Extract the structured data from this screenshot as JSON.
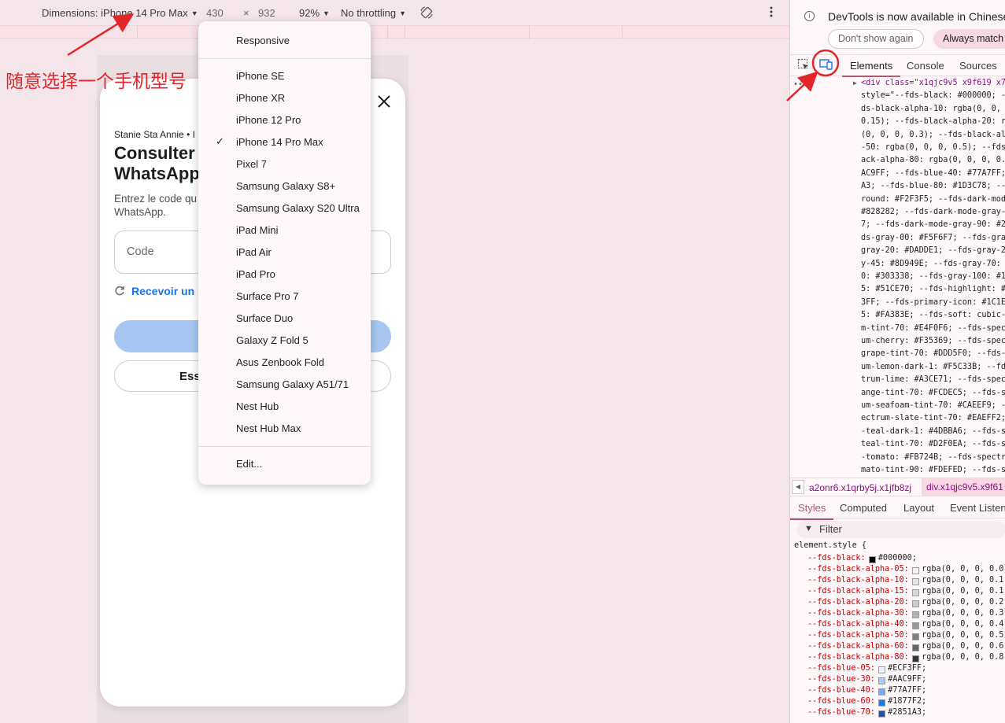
{
  "toolbar": {
    "dimensions_label": "Dimensions: iPhone 14 Pro Max",
    "width": "430",
    "times": "×",
    "height": "932",
    "zoom": "92%",
    "throttling": "No throttling"
  },
  "annotation": {
    "text": "随意选择一个手机型号"
  },
  "modal": {
    "account": "Stanie Sta Annie • I",
    "title": "Consulter\nWhatsApp",
    "description": "Entrez le code qu                                   ompte\nWhatsApp.",
    "code_placeholder": "Code",
    "resend": "Recevoir un n",
    "secondary_button": "Ess"
  },
  "device_menu": {
    "top_item": "Responsive",
    "devices": [
      "iPhone SE",
      "iPhone XR",
      "iPhone 12 Pro",
      "iPhone 14 Pro Max",
      "Pixel 7",
      "Samsung Galaxy S8+",
      "Samsung Galaxy S20 Ultra",
      "iPad Mini",
      "iPad Air",
      "iPad Pro",
      "Surface Pro 7",
      "Surface Duo",
      "Galaxy Z Fold 5",
      "Asus Zenbook Fold",
      "Samsung Galaxy A51/71",
      "Nest Hub",
      "Nest Hub Max"
    ],
    "selected": "iPhone 14 Pro Max",
    "check_glyph": "✓",
    "edit": "Edit..."
  },
  "devtools": {
    "banner_message": "DevTools is now available in Chinese",
    "dont_show": "Don't show again",
    "always_match": "Always match",
    "tabs": [
      "Elements",
      "Console",
      "Sources"
    ],
    "active_tab": "Elements",
    "code_lines": [
      "<div class=\"x1qjc9v5 x9f619 x78",
      "style=\"--fds-black: #000000; --",
      "ds-black-alpha-10: rgba(0, 0, 0",
      "0.15); --fds-black-alpha-20: rg",
      "(0, 0, 0, 0.3); --fds-black-alp",
      "-50: rgba(0, 0, 0, 0.5); --fds-",
      "ack-alpha-80: rgba(0, 0, 0, 0.8",
      "AC9FF; --fds-blue-40: #77A7FF;",
      "A3; --fds-blue-80: #1D3C78; --f",
      "round: #F2F3F5; --fds-dark-mode",
      "#828282; --fds-dark-mode-gray-7",
      "7; --fds-dark-mode-gray-90: #28",
      "ds-gray-00: #F5F6F7; --fds-gray",
      "gray-20: #DADDE1; --fds-gray-25",
      "y-45: #8D949E; --fds-gray-70: #",
      "0: #303338; --fds-gray-100: #1C",
      "5: #51CE70; --fds-highlight: #3",
      "3FF; --fds-primary-icon: #1C1E2",
      "5: #FA383E; --fds-soft: cubic-b",
      "m-tint-70: #E4F0F6; --fds-spect",
      "um-cherry: #F35369; --fds-spect",
      "grape-tint-70: #DDD5F0; --fds-s",
      "um-lemon-dark-1: #F5C33B; --fds",
      "trum-lime: #A3CE71; --fds-spect",
      "ange-tint-70: #FCDEC5; --fds-sp",
      "um-seafoam-tint-70: #CAEEF9; --",
      "ectrum-slate-tint-70: #EAEFF2;",
      "-teal-dark-1: #4DBBA6; --fds-sp",
      "teal-tint-70: #D2F0EA; --fds-sp",
      "-tomato: #FB724B; --fds-spectru",
      "mato-tint-90: #FDEFED; --fds-st"
    ],
    "breadcrumb_prev": "a2onr6.x1qrby5j.x1jfb8zj",
    "breadcrumb_current": "div.x1qjc9v5.x9f61",
    "sub_tabs": [
      "Styles",
      "Computed",
      "Layout",
      "Event Listeners"
    ],
    "active_sub_tab": "Styles",
    "filter_label": "Filter",
    "element_style_label": "element.style {",
    "style_rows": [
      {
        "prop": "--fds-black:",
        "value": "#000000;",
        "swatch": "#000000"
      },
      {
        "prop": "--fds-black-alpha-05:",
        "value": "rgba(0, 0, 0, 0.0",
        "swatch": "#f2f2f2"
      },
      {
        "prop": "--fds-black-alpha-10:",
        "value": "rgba(0, 0, 0, 0.1",
        "swatch": "#e6e6e6"
      },
      {
        "prop": "--fds-black-alpha-15:",
        "value": "rgba(0, 0, 0, 0.1",
        "swatch": "#d9d9d9"
      },
      {
        "prop": "--fds-black-alpha-20:",
        "value": "rgba(0, 0, 0, 0.2",
        "swatch": "#cccccc"
      },
      {
        "prop": "--fds-black-alpha-30:",
        "value": "rgba(0, 0, 0, 0.3",
        "swatch": "#b3b3b3"
      },
      {
        "prop": "--fds-black-alpha-40:",
        "value": "rgba(0, 0, 0, 0.4",
        "swatch": "#999999"
      },
      {
        "prop": "--fds-black-alpha-50:",
        "value": "rgba(0, 0, 0, 0.5",
        "swatch": "#808080"
      },
      {
        "prop": "--fds-black-alpha-60:",
        "value": "rgba(0, 0, 0, 0.6",
        "swatch": "#666666"
      },
      {
        "prop": "--fds-black-alpha-80:",
        "value": "rgba(0, 0, 0, 0.8",
        "swatch": "#333333"
      },
      {
        "prop": "--fds-blue-05:",
        "value": "#ECF3FF;",
        "swatch": "#ECF3FF"
      },
      {
        "prop": "--fds-blue-30:",
        "value": "#AAC9FF;",
        "swatch": "#AAC9FF"
      },
      {
        "prop": "--fds-blue-40:",
        "value": "#77A7FF;",
        "swatch": "#77A7FF"
      },
      {
        "prop": "--fds-blue-60:",
        "value": "#1877F2;",
        "swatch": "#1877F2"
      },
      {
        "prop": "--fds-blue-70:",
        "value": "#2851A3;",
        "swatch": "#2851A3"
      }
    ]
  },
  "colors": {
    "annotation_red": "#e3262a",
    "accent": "#b5566f",
    "link_blue": "#1b74e4"
  }
}
